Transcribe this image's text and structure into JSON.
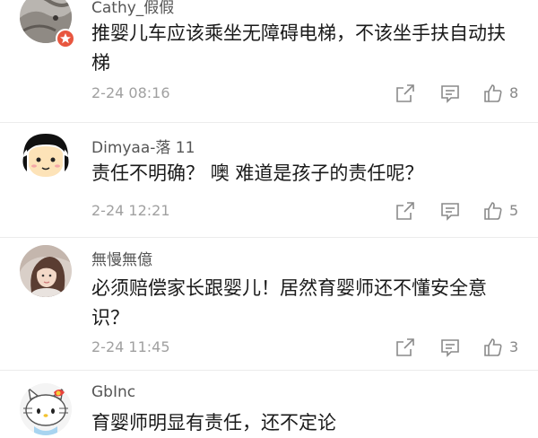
{
  "comments": [
    {
      "username": "Cathy_假假",
      "text": "推婴儿车应该乘坐无障碍电梯，不该坐手扶自动扶梯",
      "time": "2-24 08:16",
      "likes": "8"
    },
    {
      "username": "Dimyaa-落 11",
      "text": "责任不明确？ 噢 难道是孩子的责任呢？",
      "time": "2-24 12:21",
      "likes": "5"
    },
    {
      "username": "無慢無億",
      "text": "必须赔偿家长跟婴儿！居然育婴师还不懂安全意识？",
      "time": "2-24 11:45",
      "likes": "3"
    },
    {
      "username": "GbInc",
      "text": "育婴师明显有责任，还不定论"
    }
  ],
  "icons": {
    "share": "share-icon",
    "comment": "comment-icon",
    "like": "thumbs-up-icon"
  },
  "colors": {
    "badge": "#e8563f",
    "text": "#1a1a1a",
    "username": "#555555",
    "meta": "#a0a0a0"
  }
}
